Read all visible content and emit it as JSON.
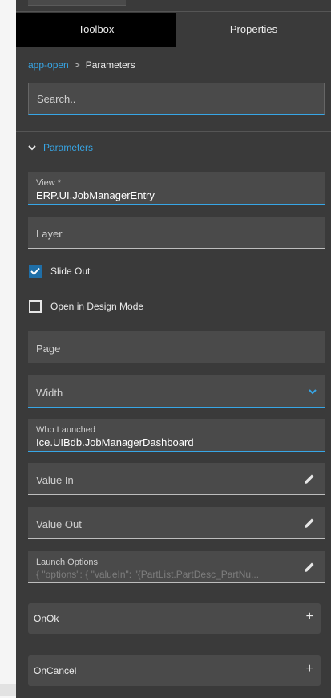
{
  "tabs": {
    "toolbox": "Toolbox",
    "properties": "Properties"
  },
  "breadcrumb": {
    "link": "app-open",
    "separator": ">",
    "current": "Parameters"
  },
  "search": {
    "placeholder": "Search.."
  },
  "section": {
    "title": "Parameters",
    "icon": "chevron-down-icon"
  },
  "fields": {
    "view": {
      "label": "View *",
      "value": "ERP.UI.JobManagerEntry"
    },
    "layer": {
      "placeholder": "Layer"
    },
    "slide_out": {
      "label": "Slide Out",
      "checked": true
    },
    "design_mode": {
      "label": "Open in Design Mode",
      "checked": false
    },
    "page": {
      "placeholder": "Page"
    },
    "width": {
      "placeholder": "Width",
      "icon": "chevron-down-icon"
    },
    "who_launched": {
      "label": "Who Launched",
      "value": "Ice.UIBdb.JobManagerDashboard"
    },
    "value_in": {
      "placeholder": "Value In",
      "icon": "pencil-icon"
    },
    "value_out": {
      "placeholder": "Value Out",
      "icon": "pencil-icon"
    },
    "launch_options": {
      "label": "Launch Options",
      "value": "{ \"options\": {   \"valueIn\": \"{PartList.PartDesc_PartNu...",
      "icon": "pencil-icon"
    }
  },
  "groups": {
    "onok": {
      "label": "OnOk",
      "plus": "+"
    },
    "oncancel": {
      "label": "OnCancel",
      "plus": "+"
    }
  },
  "colors": {
    "accent": "#37a6e6",
    "panel": "#3a3a3a",
    "field": "#4a4a4a",
    "checkbox": "#1f6fa8"
  }
}
